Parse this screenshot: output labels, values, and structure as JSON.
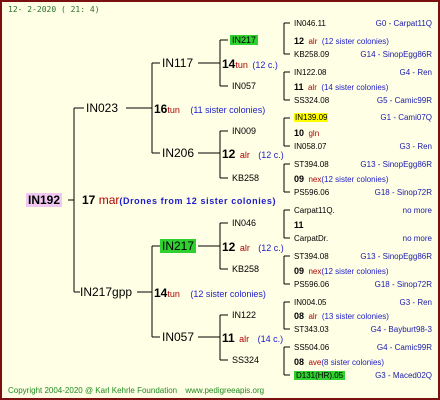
{
  "header": {
    "date": "12-  2-2020  ( 21:  4)"
  },
  "root": {
    "id": "IN192",
    "gen": "17",
    "breed": "mar",
    "note": "(Drones from 12 sister colonies)"
  },
  "gen1": [
    {
      "id": "IN023",
      "gen": "16",
      "breed": "tun",
      "note": "(11 sister colonies)"
    },
    {
      "id": "IN217gpp",
      "gen": "14",
      "breed": "tun",
      "note": "(12 sister colonies)"
    }
  ],
  "gen2": [
    {
      "id": "IN117",
      "gen": "14",
      "breed": "tun",
      "note": "(12 c.)"
    },
    {
      "id": "IN206",
      "gen": "12",
      "breed": "alr",
      "note": "(12 c.)"
    },
    {
      "id": "IN217",
      "gen": "12",
      "breed": "alr",
      "note": "(12 c.)"
    },
    {
      "id": "IN057",
      "gen": "11",
      "breed": "alr",
      "note": "(14 c.)"
    }
  ],
  "gen3": [
    {
      "id": "IN217",
      "gen": "12",
      "breed": "alr",
      "note": "(12 sister colonies)"
    },
    {
      "id": "IN057",
      "gen": "11",
      "breed": "alr",
      "note": "(14 sister colonies)"
    },
    {
      "id": "IN009",
      "gen": "10",
      "breed": "gln",
      "note": ""
    },
    {
      "id": "KB258",
      "gen": "09",
      "breed": "nex",
      "note": "(12 sister colonies)"
    },
    {
      "id": "IN046",
      "gen": "11",
      "breed": "",
      "note": ""
    },
    {
      "id": "KB258",
      "gen": "09",
      "breed": "nex",
      "note": "(12 sister colonies)"
    },
    {
      "id": "IN122",
      "gen": "08",
      "breed": "alr",
      "note": "(13 sister colonies)"
    },
    {
      "id": "SS324",
      "gen": "08",
      "breed": "ave",
      "note": "(8 sister colonies)"
    }
  ],
  "gen4": [
    {
      "id": "IN046.11",
      "tag": "G0 - Carpat11Q"
    },
    {
      "id": "KB258.09",
      "tag": "G14 - SinopEgg86R"
    },
    {
      "id": "IN122.08",
      "tag": "G4 - Ren"
    },
    {
      "id": "SS324.08",
      "tag": "G5 - Camic99R"
    },
    {
      "id": "IN139.09",
      "tag": "G1 - Cami07Q"
    },
    {
      "id": "IN058.07",
      "tag": "G3 - Ren"
    },
    {
      "id": "ST394.08",
      "tag": "G13 - SinopEgg86R"
    },
    {
      "id": "PS596.06",
      "tag": "G18 - Sinop72R"
    },
    {
      "id": "Carpat11Q.",
      "tag": "no more"
    },
    {
      "id": "CarpatDr.",
      "tag": "no more"
    },
    {
      "id": "ST394.08",
      "tag": "G13 - SinopEgg86R"
    },
    {
      "id": "PS596.06",
      "tag": "G18 - Sinop72R"
    },
    {
      "id": "IN004.05",
      "tag": "G3 - Ren"
    },
    {
      "id": "ST343.03",
      "tag": "G4 - Bayburt98-3"
    },
    {
      "id": "SS504.06",
      "tag": "G4 - Camic99R"
    },
    {
      "id": "D131(HR).05",
      "tag": "G3 - Maced02Q"
    }
  ],
  "footer": {
    "copyright": "Copyright 2004-2020 @ Karl Kehrle Foundation",
    "site": "www.pedigreeapis.org"
  },
  "colors": {
    "border": "#7a1010",
    "background": "#ffffe6",
    "highlight_green": "#2fd02f",
    "highlight_yellow": "#ffff00",
    "highlight_pink": "#f2c8f2"
  }
}
